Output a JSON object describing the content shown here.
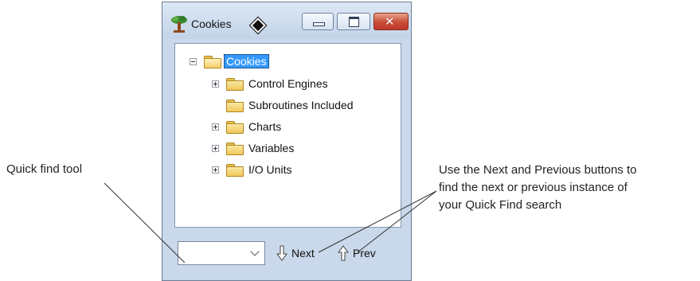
{
  "window": {
    "title": "Cookies"
  },
  "tree": {
    "root": {
      "label": "Cookies",
      "expanded": true,
      "selected": true
    },
    "children": [
      {
        "label": "Control Engines",
        "expandable": true
      },
      {
        "label": "Subroutines Included",
        "expandable": false
      },
      {
        "label": "Charts",
        "expandable": true
      },
      {
        "label": "Variables",
        "expandable": true
      },
      {
        "label": "I/O Units",
        "expandable": true
      }
    ]
  },
  "bottom_bar": {
    "quick_find_value": "",
    "next_label": "Next",
    "prev_label": "Prev"
  },
  "callouts": {
    "quick_find": "Quick find tool",
    "next_prev_line1": "Use the Next and Previous buttons to",
    "next_prev_line2": "find the next or previous instance of",
    "next_prev_line3": "your Quick Find search"
  },
  "colors": {
    "selection": "#3399ff",
    "close_button": "#c84c35",
    "folder": "#f0c85a"
  }
}
